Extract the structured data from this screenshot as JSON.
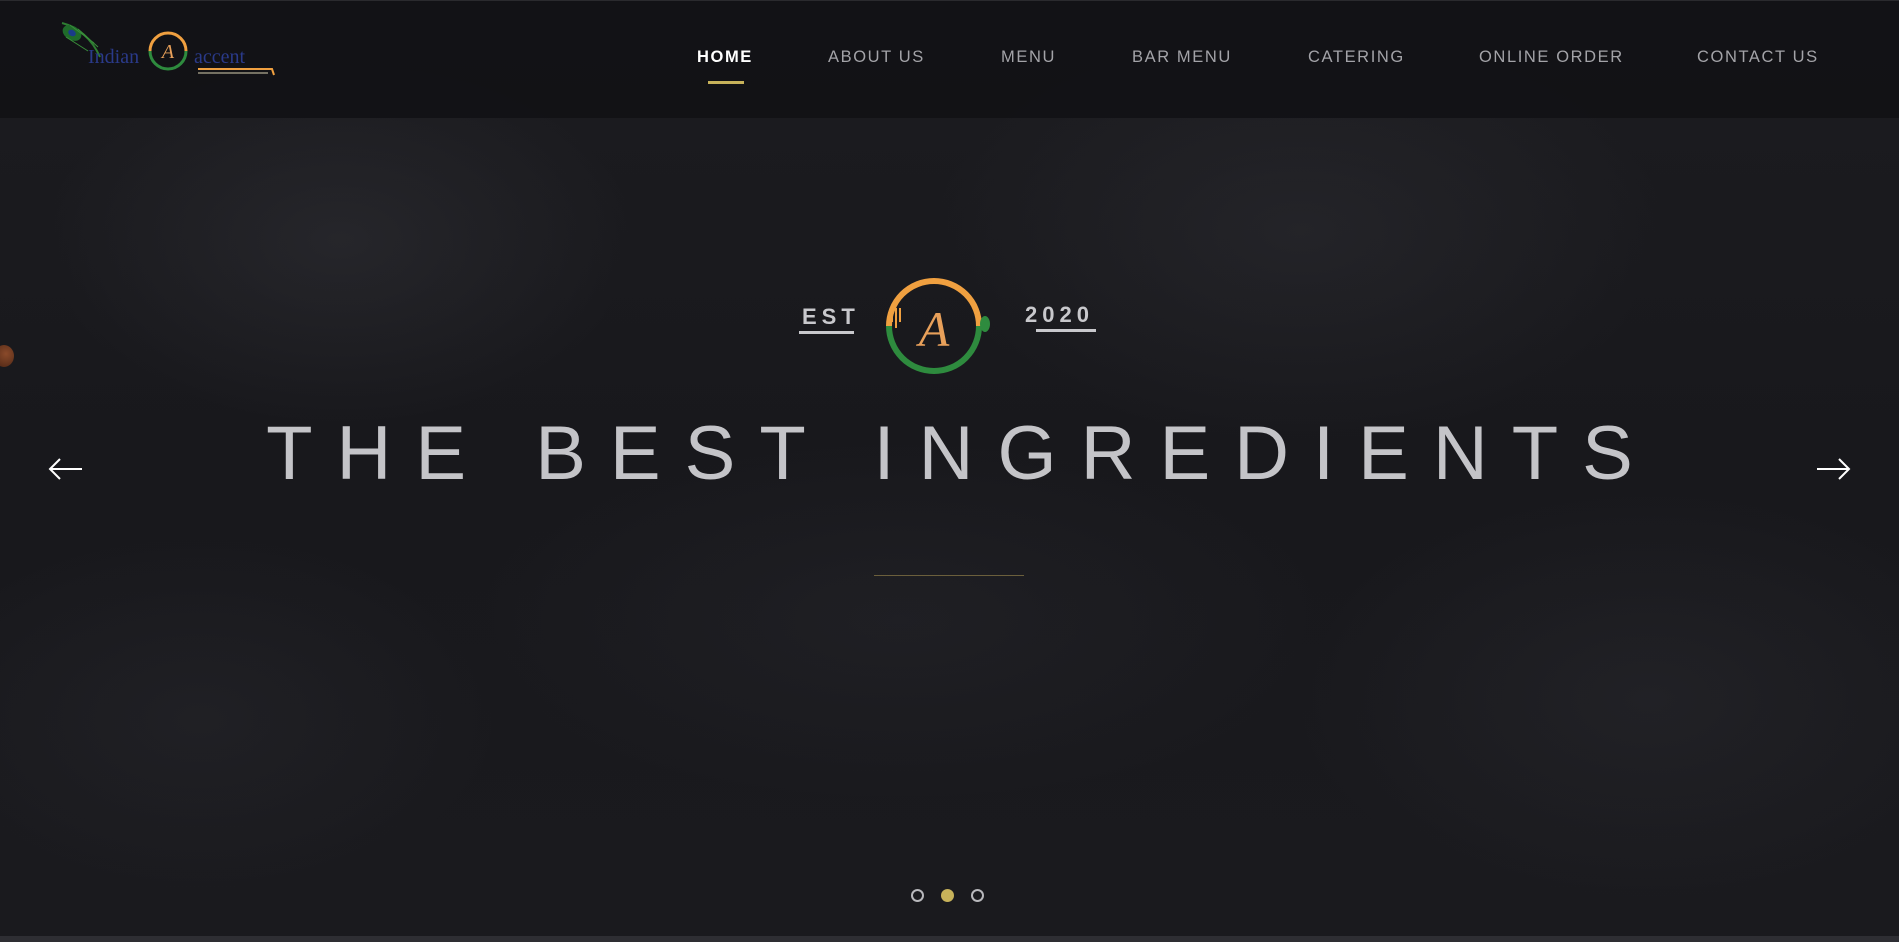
{
  "brand": {
    "logo_word_1": "Indian",
    "logo_word_2": "accent",
    "logo_monogram": "A"
  },
  "nav": {
    "items": [
      {
        "label": "HOME",
        "active": true
      },
      {
        "label": "ABOUT US",
        "active": false
      },
      {
        "label": "MENU",
        "active": false
      },
      {
        "label": "BAR MENU",
        "active": false
      },
      {
        "label": "CATERING",
        "active": false
      },
      {
        "label": "ONLINE ORDER",
        "active": false
      },
      {
        "label": "CONTACT US",
        "active": false
      }
    ]
  },
  "hero": {
    "est_label": "EST",
    "year": "2020",
    "monogram": "A",
    "title": "THE BEST INGREDIENTS"
  },
  "slider": {
    "prev_icon": "arrow-left-icon",
    "next_icon": "arrow-right-icon",
    "slide_count": 3,
    "active_slide": 2
  },
  "colors": {
    "accent_gold": "#c7b25a",
    "logo_orange": "#f0a040",
    "logo_green": "#2e8b3e",
    "background": "#18181c"
  }
}
